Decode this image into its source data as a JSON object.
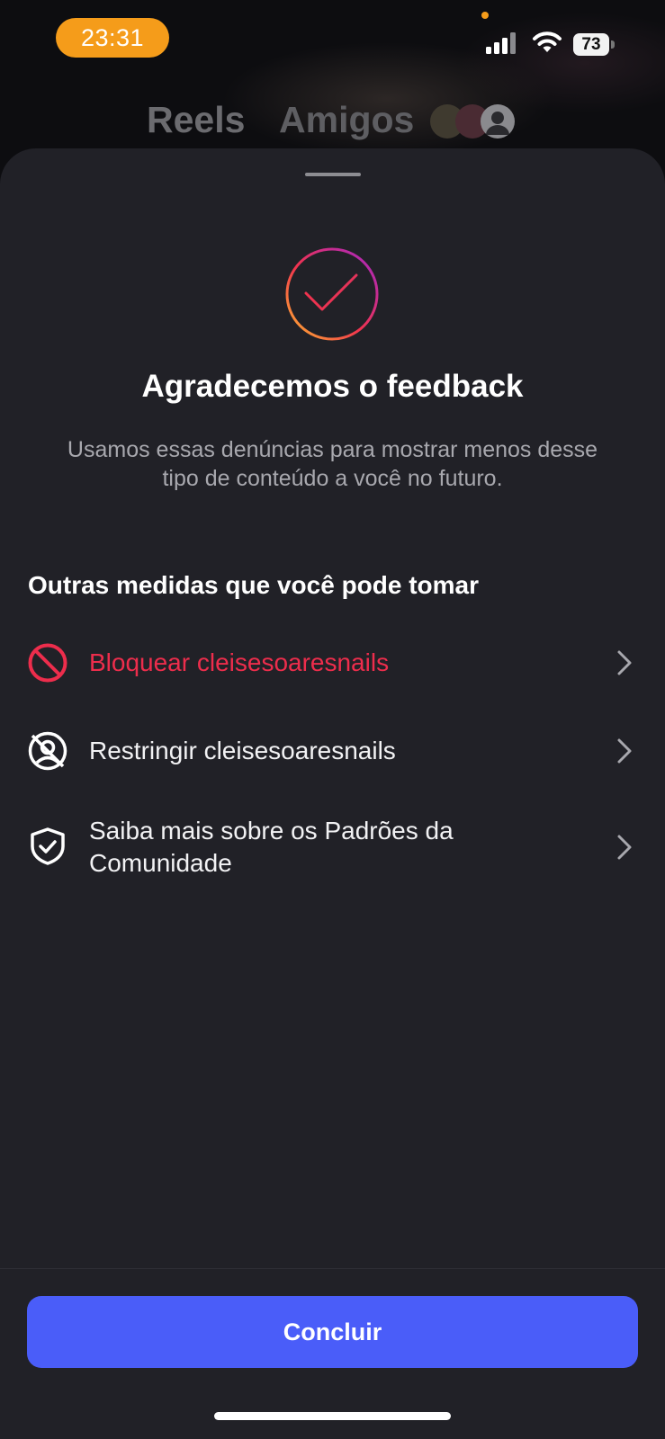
{
  "status_bar": {
    "time": "23:31",
    "battery": "73",
    "time_pill_color": "#f59c1a"
  },
  "background_tabs": {
    "reels": "Reels",
    "friends": "Amigos"
  },
  "sheet": {
    "title": "Agradecemos o feedback",
    "subtitle": "Usamos essas denúncias para mostrar menos desse tipo de conteúdo a você no futuro.",
    "section_title": "Outras medidas que você pode tomar",
    "actions": [
      {
        "label": "Bloquear cleisesoaresnails",
        "icon": "block-icon",
        "color": "#ed2d4c"
      },
      {
        "label": "Restringir cleisesoaresnails",
        "icon": "restrict-icon"
      },
      {
        "label": "Saiba mais sobre os Padrões da Comunidade",
        "icon": "shield-check-icon"
      }
    ],
    "done_label": "Concluir",
    "done_color": "#4a5df9"
  }
}
